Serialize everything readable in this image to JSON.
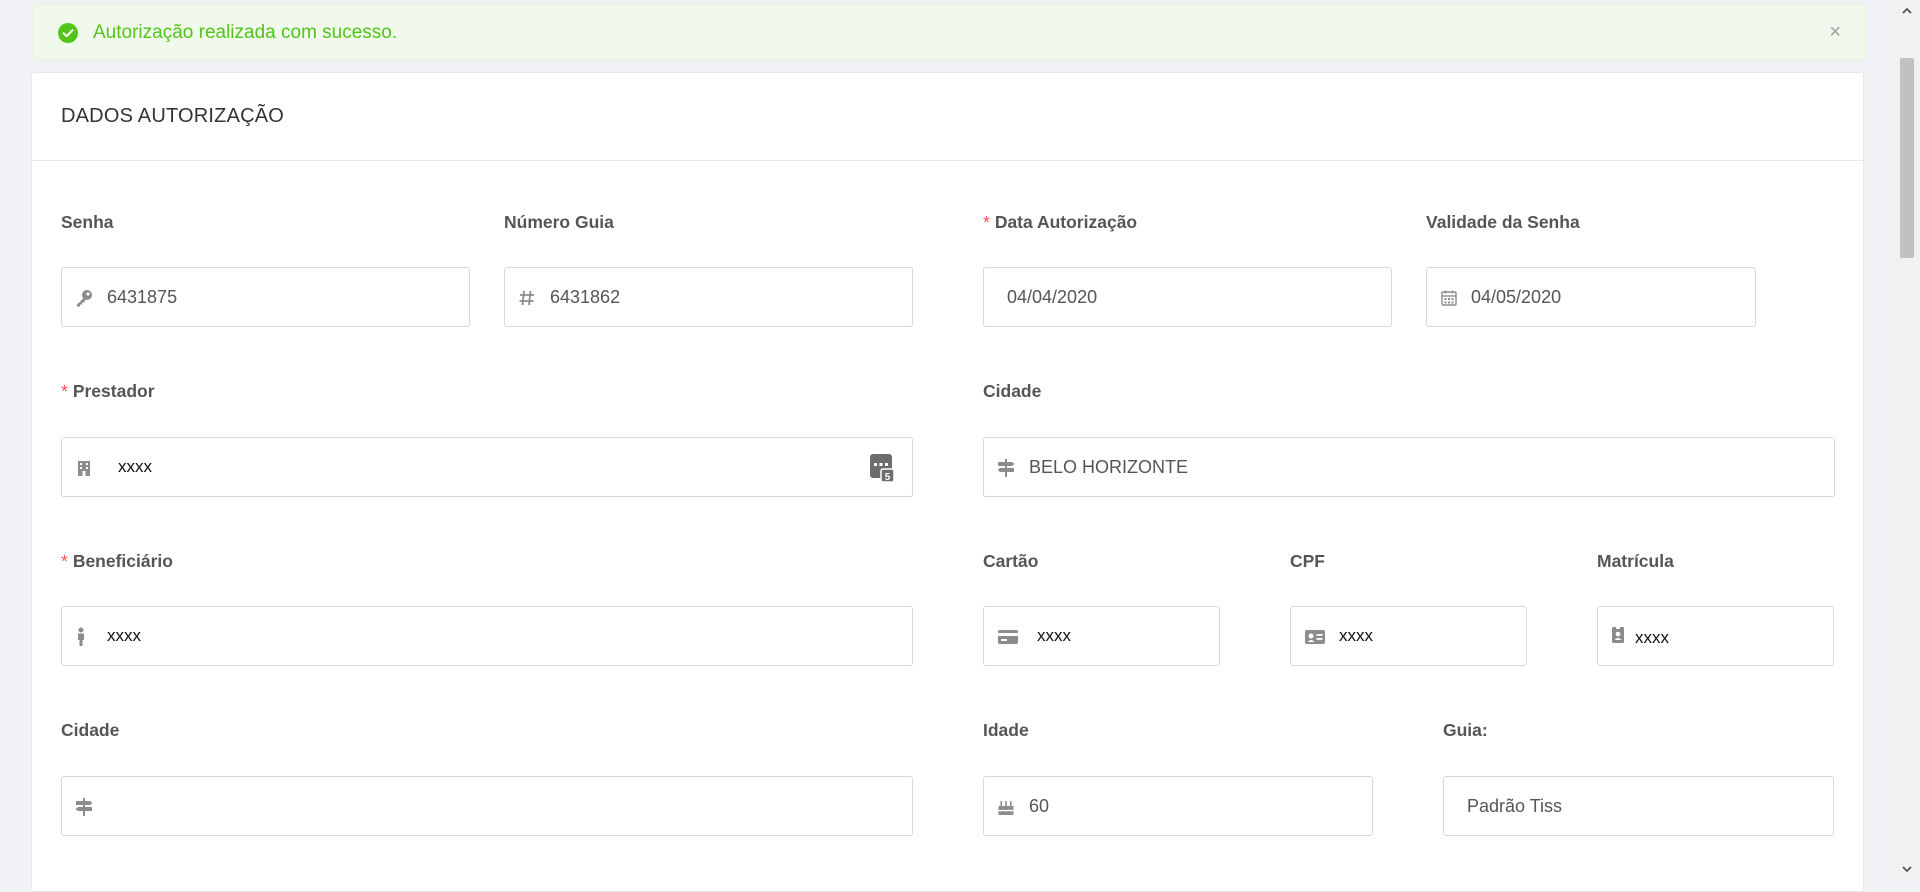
{
  "alert": {
    "message": "Autorização realizada com sucesso.",
    "close_symbol": "×",
    "colors": {
      "bg": "#f0f9eb",
      "text": "#52c41a"
    }
  },
  "card": {
    "title": "DADOS AUTORIZAÇÃO"
  },
  "required_marker": "*",
  "fields": {
    "senha": {
      "label": "Senha",
      "value": "6431875",
      "icon": "key-icon"
    },
    "numero_guia": {
      "label": "Número Guia",
      "value": "6431862",
      "icon": "hash-icon"
    },
    "data_autorizacao": {
      "label": "Data Autorização",
      "value": "04/04/2020",
      "required": true
    },
    "validade_senha": {
      "label": "Validade da Senha",
      "value": "04/05/2020",
      "icon": "calendar-icon"
    },
    "prestador": {
      "label": "Prestador",
      "value": "xxxx",
      "required": true,
      "icon": "building-icon",
      "action_icon": "calculator-icon"
    },
    "cidade_prestador": {
      "label": "Cidade",
      "value": "BELO HORIZONTE",
      "icon": "signpost-icon"
    },
    "beneficiario": {
      "label": "Beneficiário",
      "value": "xxxx",
      "required": true,
      "icon": "person-icon"
    },
    "cartao": {
      "label": "Cartão",
      "value": "xxxx",
      "icon": "credit-card-icon"
    },
    "cpf": {
      "label": "CPF",
      "value": "xxxx",
      "icon": "id-card-icon"
    },
    "matricula": {
      "label": "Matrícula",
      "value": "xxxx",
      "icon": "badge-icon"
    },
    "cidade_beneficiario": {
      "label": "Cidade",
      "value": "",
      "icon": "signpost-icon"
    },
    "idade": {
      "label": "Idade",
      "value": "60",
      "icon": "birthday-cake-icon"
    },
    "guia": {
      "label": "Guia:",
      "value": "Padrão Tiss"
    }
  }
}
